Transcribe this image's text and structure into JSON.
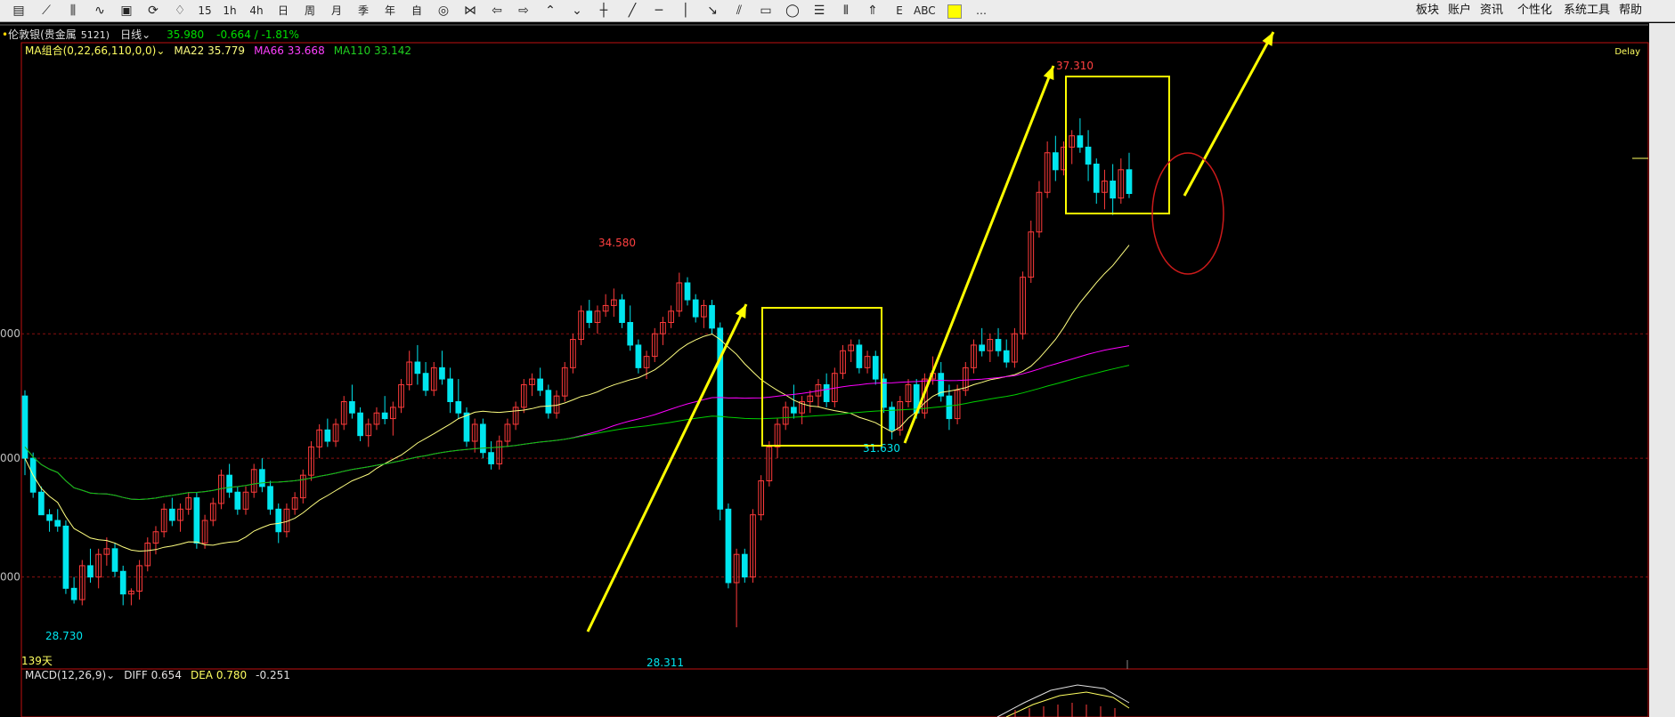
{
  "toolbar": {
    "tools": [
      {
        "x": 9,
        "text": "",
        "icon": "table-icon"
      },
      {
        "x": 40,
        "text": "",
        "icon": "line-chart-icon"
      },
      {
        "x": 70,
        "text": "",
        "icon": "kline-icon"
      },
      {
        "x": 100,
        "text": "",
        "icon": "indicator-icon"
      },
      {
        "x": 130,
        "text": "",
        "icon": "panel-icon"
      },
      {
        "x": 160,
        "text": "",
        "icon": "refresh-icon"
      },
      {
        "x": 190,
        "text": "",
        "icon": "alarm-icon"
      },
      {
        "x": 218,
        "text": "15",
        "icon": ""
      },
      {
        "x": 246,
        "text": "1h",
        "icon": ""
      },
      {
        "x": 276,
        "text": "4h",
        "icon": ""
      },
      {
        "x": 306,
        "text": "日",
        "icon": ""
      },
      {
        "x": 336,
        "text": "周",
        "icon": ""
      },
      {
        "x": 366,
        "text": "月",
        "icon": ""
      },
      {
        "x": 396,
        "text": "季",
        "icon": ""
      },
      {
        "x": 426,
        "text": "年",
        "icon": ""
      },
      {
        "x": 456,
        "text": "自",
        "icon": ""
      },
      {
        "x": 486,
        "text": "",
        "icon": "eye-icon"
      },
      {
        "x": 516,
        "text": "",
        "icon": "arrows-icon"
      },
      {
        "x": 546,
        "text": "",
        "icon": "back-icon"
      },
      {
        "x": 576,
        "text": "",
        "icon": "forward-icon"
      },
      {
        "x": 606,
        "text": "",
        "icon": "up-icon"
      },
      {
        "x": 636,
        "text": "",
        "icon": "down-icon"
      },
      {
        "x": 666,
        "text": "",
        "icon": "crosshair-icon"
      },
      {
        "x": 698,
        "text": "",
        "icon": "draw-line-icon"
      },
      {
        "x": 728,
        "text": "",
        "icon": "hline-icon"
      },
      {
        "x": 758,
        "text": "",
        "icon": "vline-icon"
      },
      {
        "x": 788,
        "text": "",
        "icon": "ray-icon"
      },
      {
        "x": 818,
        "text": "",
        "icon": "parallel-icon"
      },
      {
        "x": 848,
        "text": "",
        "icon": "rectangle-icon"
      },
      {
        "x": 878,
        "text": "",
        "icon": "ellipse-icon"
      },
      {
        "x": 908,
        "text": "",
        "icon": "fib-icon"
      },
      {
        "x": 938,
        "text": "",
        "icon": "gann-icon"
      },
      {
        "x": 968,
        "text": "",
        "icon": "pitchfork-icon"
      },
      {
        "x": 998,
        "text": "E",
        "icon": ""
      },
      {
        "x": 1026,
        "text": "ABC",
        "icon": ""
      },
      {
        "x": 1060,
        "text": "",
        "icon": "color-swatch-icon"
      },
      {
        "x": 1090,
        "text": "…",
        "icon": ""
      }
    ],
    "menu": [
      "板块",
      "账户",
      "资讯",
      "个性化",
      "系统工具",
      "帮助"
    ]
  },
  "instrument": {
    "name": "伦敦银(贵金属",
    "code": "5121)",
    "period": "日线",
    "price": "35.980",
    "change": "-0.664 / -1.81%"
  },
  "indicator": {
    "label": "MA组合(0,22,66,110,0,0)",
    "ma22": "MA22 35.779",
    "ma66": "MA66 33.668",
    "ma110": "MA110 33.142"
  },
  "macd": {
    "label": "MACD(12,26,9)",
    "diff": "DIFF 0.654",
    "dea": "DEA 0.780",
    "value": "-0.251"
  },
  "chart_labels": {
    "delay": "Delay",
    "high1": "34.580",
    "high2": "37.310",
    "low1": "28.730",
    "low2": "28.311",
    "low3": "31.630",
    "days": "139天",
    "axis": [
      "000",
      "000",
      "000"
    ]
  },
  "colors": {
    "up": "#ff3b3b",
    "down": "#00e5ee",
    "ma22": "#ffff80",
    "ma66": "#ff00ff",
    "ma110": "#00d000",
    "annotation": "#ffff00",
    "border": "#c01010"
  },
  "chart_data": {
    "type": "candlestick",
    "title": "伦敦银(贵金属 5121) 日线",
    "ylim": [
      27.7,
      38.3
    ],
    "bars": 139,
    "ohlc": [
      [
        32.4,
        32.5,
        31.0,
        31.3
      ],
      [
        31.3,
        31.4,
        30.6,
        30.7
      ],
      [
        30.7,
        30.8,
        30.3,
        30.3
      ],
      [
        30.3,
        30.4,
        30.0,
        30.2
      ],
      [
        30.2,
        30.4,
        30.0,
        30.1
      ],
      [
        30.1,
        30.2,
        28.9,
        29.0
      ],
      [
        29.0,
        29.2,
        28.73,
        28.8
      ],
      [
        28.8,
        29.5,
        28.7,
        29.4
      ],
      [
        29.4,
        29.7,
        29.1,
        29.2
      ],
      [
        29.2,
        29.7,
        29.0,
        29.6
      ],
      [
        29.6,
        29.9,
        29.4,
        29.7
      ],
      [
        29.7,
        29.8,
        29.2,
        29.3
      ],
      [
        29.3,
        29.4,
        28.7,
        28.9
      ],
      [
        28.9,
        29.0,
        28.7,
        28.95
      ],
      [
        28.95,
        29.5,
        28.8,
        29.4
      ],
      [
        29.4,
        29.9,
        29.3,
        29.8
      ],
      [
        29.8,
        30.1,
        29.6,
        30.0
      ],
      [
        30.0,
        30.5,
        29.9,
        30.4
      ],
      [
        30.4,
        30.6,
        30.1,
        30.2
      ],
      [
        30.2,
        30.5,
        30.0,
        30.4
      ],
      [
        30.4,
        30.7,
        30.3,
        30.6
      ],
      [
        30.6,
        30.7,
        29.7,
        29.8
      ],
      [
        29.8,
        30.3,
        29.7,
        30.2
      ],
      [
        30.2,
        30.6,
        30.1,
        30.5
      ],
      [
        30.5,
        31.1,
        30.4,
        31.0
      ],
      [
        31.0,
        31.2,
        30.6,
        30.7
      ],
      [
        30.7,
        30.8,
        30.3,
        30.4
      ],
      [
        30.4,
        30.8,
        30.3,
        30.7
      ],
      [
        30.7,
        31.2,
        30.6,
        31.1
      ],
      [
        31.1,
        31.3,
        30.7,
        30.8
      ],
      [
        30.8,
        30.9,
        30.3,
        30.4
      ],
      [
        30.4,
        30.5,
        29.8,
        30.0
      ],
      [
        30.0,
        30.5,
        29.9,
        30.4
      ],
      [
        30.4,
        30.7,
        30.3,
        30.6
      ],
      [
        30.6,
        31.1,
        30.5,
        31.0
      ],
      [
        31.0,
        31.6,
        30.9,
        31.5
      ],
      [
        31.5,
        31.9,
        31.3,
        31.8
      ],
      [
        31.8,
        32.0,
        31.5,
        31.6
      ],
      [
        31.6,
        32.0,
        31.5,
        31.9
      ],
      [
        31.9,
        32.4,
        31.8,
        32.3
      ],
      [
        32.3,
        32.6,
        32.0,
        32.1
      ],
      [
        32.1,
        32.2,
        31.6,
        31.7
      ],
      [
        31.7,
        32.0,
        31.5,
        31.9
      ],
      [
        31.9,
        32.2,
        31.8,
        32.1
      ],
      [
        32.1,
        32.4,
        31.9,
        32.0
      ],
      [
        32.0,
        32.3,
        31.7,
        32.2
      ],
      [
        32.2,
        32.7,
        32.1,
        32.6
      ],
      [
        32.6,
        33.2,
        32.5,
        33.0
      ],
      [
        33.0,
        33.3,
        32.6,
        32.8
      ],
      [
        32.8,
        33.0,
        32.4,
        32.5
      ],
      [
        32.5,
        33.0,
        32.4,
        32.9
      ],
      [
        32.9,
        33.2,
        32.6,
        32.7
      ],
      [
        32.7,
        32.9,
        32.1,
        32.3
      ],
      [
        32.3,
        32.7,
        32.0,
        32.1
      ],
      [
        32.1,
        32.2,
        31.5,
        31.6
      ],
      [
        31.6,
        32.0,
        31.4,
        31.9
      ],
      [
        31.9,
        32.0,
        31.3,
        31.4
      ],
      [
        31.4,
        31.6,
        31.1,
        31.2
      ],
      [
        31.2,
        31.7,
        31.1,
        31.6
      ],
      [
        31.6,
        32.0,
        31.5,
        31.9
      ],
      [
        31.9,
        32.3,
        31.8,
        32.2
      ],
      [
        32.2,
        32.7,
        32.1,
        32.6
      ],
      [
        32.6,
        32.8,
        32.4,
        32.7
      ],
      [
        32.7,
        32.9,
        32.4,
        32.5
      ],
      [
        32.5,
        32.6,
        32.0,
        32.1
      ],
      [
        32.1,
        32.5,
        32.0,
        32.4
      ],
      [
        32.4,
        33.0,
        32.3,
        32.9
      ],
      [
        32.9,
        33.5,
        32.8,
        33.4
      ],
      [
        33.4,
        34.0,
        33.3,
        33.9
      ],
      [
        33.9,
        34.1,
        33.6,
        33.7
      ],
      [
        33.7,
        34.0,
        33.5,
        33.9
      ],
      [
        33.9,
        34.2,
        33.8,
        34.0
      ],
      [
        34.0,
        34.3,
        33.8,
        34.1
      ],
      [
        34.1,
        34.2,
        33.6,
        33.7
      ],
      [
        33.7,
        34.0,
        33.2,
        33.3
      ],
      [
        33.3,
        33.4,
        32.8,
        32.9
      ],
      [
        32.9,
        33.2,
        32.7,
        33.1
      ],
      [
        33.1,
        33.6,
        33.0,
        33.5
      ],
      [
        33.5,
        33.8,
        33.3,
        33.7
      ],
      [
        33.7,
        34.0,
        33.6,
        33.9
      ],
      [
        33.9,
        34.58,
        33.8,
        34.4
      ],
      [
        34.4,
        34.5,
        34.0,
        34.1
      ],
      [
        34.1,
        34.2,
        33.7,
        33.8
      ],
      [
        33.8,
        34.1,
        33.6,
        34.0
      ],
      [
        34.0,
        34.1,
        33.5,
        33.6
      ],
      [
        33.6,
        33.7,
        30.2,
        30.4
      ],
      [
        30.4,
        30.5,
        29.0,
        29.1
      ],
      [
        29.1,
        29.7,
        28.311,
        29.6
      ],
      [
        29.6,
        29.7,
        29.1,
        29.2
      ],
      [
        29.2,
        30.4,
        29.1,
        30.3
      ],
      [
        30.3,
        31.0,
        30.2,
        30.9
      ],
      [
        30.9,
        31.6,
        30.8,
        31.5
      ],
      [
        31.5,
        32.0,
        31.3,
        31.9
      ],
      [
        31.9,
        32.3,
        31.8,
        32.2
      ],
      [
        32.2,
        32.6,
        32.0,
        32.1
      ],
      [
        32.1,
        32.4,
        31.9,
        32.3
      ],
      [
        32.3,
        32.5,
        32.1,
        32.4
      ],
      [
        32.4,
        32.7,
        32.2,
        32.6
      ],
      [
        32.6,
        32.8,
        32.2,
        32.3
      ],
      [
        32.3,
        32.9,
        32.2,
        32.8
      ],
      [
        32.8,
        33.3,
        32.7,
        33.2
      ],
      [
        33.2,
        33.4,
        33.0,
        33.3
      ],
      [
        33.3,
        33.4,
        32.8,
        32.9
      ],
      [
        32.9,
        33.2,
        32.8,
        33.1
      ],
      [
        33.1,
        33.2,
        32.6,
        32.7
      ],
      [
        32.7,
        32.8,
        32.1,
        32.2
      ],
      [
        32.2,
        32.3,
        31.63,
        31.8
      ],
      [
        31.8,
        32.4,
        31.7,
        32.3
      ],
      [
        32.3,
        32.7,
        32.2,
        32.6
      ],
      [
        32.6,
        32.7,
        32.0,
        32.1
      ],
      [
        32.1,
        32.8,
        32.0,
        32.7
      ],
      [
        32.7,
        33.1,
        32.6,
        32.8
      ],
      [
        32.8,
        33.0,
        32.3,
        32.4
      ],
      [
        32.4,
        32.6,
        31.8,
        32.0
      ],
      [
        32.0,
        32.6,
        31.9,
        32.5
      ],
      [
        32.5,
        33.0,
        32.4,
        32.9
      ],
      [
        32.9,
        33.4,
        32.8,
        33.3
      ],
      [
        33.3,
        33.6,
        33.1,
        33.2
      ],
      [
        33.2,
        33.5,
        33.0,
        33.4
      ],
      [
        33.4,
        33.6,
        33.1,
        33.2
      ],
      [
        33.2,
        33.4,
        32.9,
        33.0
      ],
      [
        33.0,
        33.6,
        32.9,
        33.5
      ],
      [
        33.5,
        34.6,
        33.4,
        34.5
      ],
      [
        34.5,
        35.5,
        34.4,
        35.3
      ],
      [
        35.3,
        36.2,
        35.2,
        36.0
      ],
      [
        36.0,
        36.9,
        35.9,
        36.7
      ],
      [
        36.7,
        37.0,
        36.2,
        36.4
      ],
      [
        36.4,
        36.9,
        36.3,
        36.8
      ],
      [
        36.8,
        37.1,
        36.5,
        37.0
      ],
      [
        37.0,
        37.31,
        36.7,
        36.8
      ],
      [
        36.8,
        37.1,
        36.2,
        36.5
      ],
      [
        36.5,
        36.6,
        35.8,
        36.0
      ],
      [
        36.0,
        36.4,
        35.7,
        36.2
      ],
      [
        36.2,
        36.5,
        35.6,
        35.9
      ],
      [
        35.9,
        36.6,
        35.8,
        36.4
      ],
      [
        36.4,
        36.7,
        35.9,
        35.98
      ]
    ],
    "ma22_end": 35.779,
    "ma66_end": 33.668,
    "ma110_end": 33.142
  }
}
